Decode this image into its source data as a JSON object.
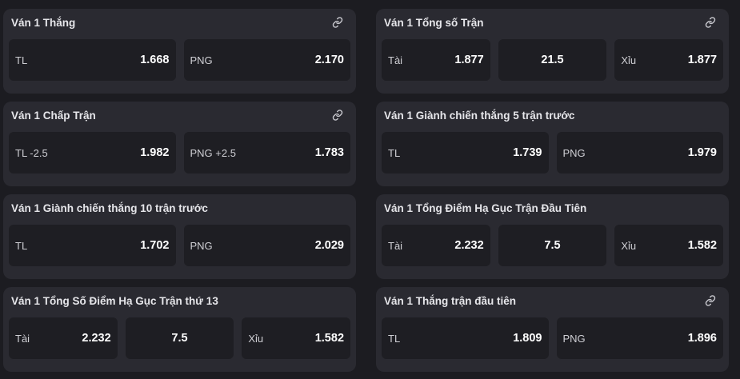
{
  "cards": [
    {
      "title": "Ván 1 Thắng",
      "has_link": true,
      "cells": [
        {
          "label": "TL",
          "odds": "1.668"
        },
        {
          "label": "PNG",
          "odds": "2.170"
        }
      ]
    },
    {
      "title": "Ván 1 Tổng số Trận",
      "has_link": true,
      "cells": [
        {
          "label": "Tài",
          "odds": "1.877"
        },
        {
          "line": "21.5"
        },
        {
          "label": "Xỉu",
          "odds": "1.877"
        }
      ]
    },
    {
      "title": "Ván 1 Chấp Trận",
      "has_link": true,
      "cells": [
        {
          "label": "TL -2.5",
          "odds": "1.982"
        },
        {
          "label": "PNG +2.5",
          "odds": "1.783"
        }
      ]
    },
    {
      "title": "Ván 1 Giành chiến thắng 5 trận trước",
      "has_link": false,
      "cells": [
        {
          "label": "TL",
          "odds": "1.739"
        },
        {
          "label": "PNG",
          "odds": "1.979"
        }
      ]
    },
    {
      "title": "Ván 1 Giành chiến thắng 10 trận trước",
      "has_link": false,
      "cells": [
        {
          "label": "TL",
          "odds": "1.702"
        },
        {
          "label": "PNG",
          "odds": "2.029"
        }
      ]
    },
    {
      "title": "Ván 1 Tổng Điểm Hạ Gục Trận Đầu Tiên",
      "has_link": false,
      "cells": [
        {
          "label": "Tài",
          "odds": "2.232"
        },
        {
          "line": "7.5"
        },
        {
          "label": "Xỉu",
          "odds": "1.582"
        }
      ]
    },
    {
      "title": "Ván 1 Tổng Số Điểm Hạ Gục Trận thứ 13",
      "has_link": false,
      "cells": [
        {
          "label": "Tài",
          "odds": "2.232"
        },
        {
          "line": "7.5"
        },
        {
          "label": "Xỉu",
          "odds": "1.582"
        }
      ]
    },
    {
      "title": "Ván 1 Thắng trận đầu tiên",
      "has_link": true,
      "cells": [
        {
          "label": "TL",
          "odds": "1.809"
        },
        {
          "label": "PNG",
          "odds": "1.896"
        }
      ]
    }
  ],
  "icons": {
    "link": "link-icon"
  },
  "colors": {
    "background": "#1c1c21",
    "card": "#2a2a31",
    "cell": "#1e1e23",
    "icon": "#c9c9cf"
  }
}
